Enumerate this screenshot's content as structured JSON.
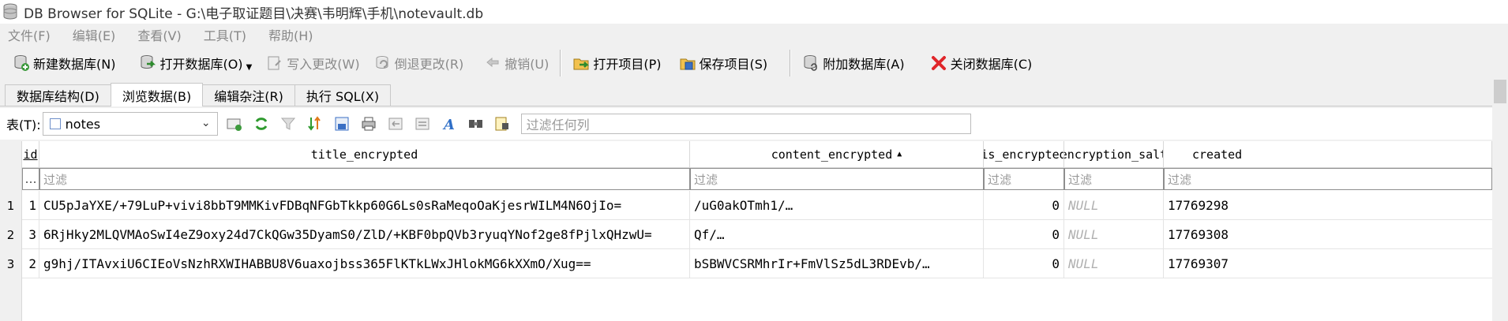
{
  "window": {
    "title": "DB Browser for SQLite - G:\\电子取证题目\\决赛\\韦明辉\\手机\\notevault.db",
    "icon": "database-icon"
  },
  "menu": {
    "items": [
      "文件(F)",
      "编辑(E)",
      "查看(V)",
      "工具(T)",
      "帮助(H)"
    ]
  },
  "toolbar": {
    "new_db": "新建数据库(N)",
    "open_db": "打开数据库(O)",
    "write_changes": "写入更改(W)",
    "revert_changes": "倒退更改(R)",
    "undo": "撤销(U)",
    "open_project": "打开项目(P)",
    "save_project": "保存项目(S)",
    "attach_db": "附加数据库(A)",
    "close_db": "关闭数据库(C)"
  },
  "tabs": [
    {
      "label": "数据库结构(D)",
      "active": false
    },
    {
      "label": "浏览数据(B)",
      "active": true
    },
    {
      "label": "编辑杂注(R)",
      "active": false
    },
    {
      "label": "执行 SQL(X)",
      "active": false
    }
  ],
  "browse": {
    "table_label": "表(T):",
    "table_value": "notes",
    "filter_all_placeholder": "过滤任何列"
  },
  "grid": {
    "columns": [
      "id",
      "title_encrypted",
      "content_encrypted",
      "is_encrypted",
      "encryption_salt",
      "created"
    ],
    "sorted_column": "content_encrypted",
    "sort_indicator": "▲",
    "filter_corner": "…",
    "filter_placeholder": "过滤",
    "null_text": "NULL",
    "rows": [
      {
        "num": "1",
        "id": "1",
        "title_encrypted": "CU5pJaYXE/+79LuP+vivi8bbT9MMKivFDBqNFGbTkkp60G6Ls0sRaMeqoOaKjesrWILM4N6OjIo=",
        "content_encrypted": "/uG0akOTmh1/…",
        "is_encrypted": "0",
        "encryption_salt": "NULL",
        "created": "17769298"
      },
      {
        "num": "2",
        "id": "3",
        "title_encrypted": "6RjHky2MLQVMAoSwI4eZ9oxy24d7CkQGw35DyamS0/ZlD/+KBF0bpQVb3ryuqYNof2ge8fPjlxQHzwU=",
        "content_encrypted": "Qf/…",
        "is_encrypted": "0",
        "encryption_salt": "NULL",
        "created": "17769308"
      },
      {
        "num": "3",
        "id": "2",
        "title_encrypted": "g9hj/ITAvxiU6CIEoVsNzhRXWIHABBU8V6uaxojbss365FlKTkLWxJHlokMG6kXXmO/Xug==",
        "content_encrypted": "bSBWVCSRMhrIr+FmVlSz5dL3RDEvb/…",
        "is_encrypted": "0",
        "encryption_salt": "NULL",
        "created": "17769307"
      }
    ]
  }
}
